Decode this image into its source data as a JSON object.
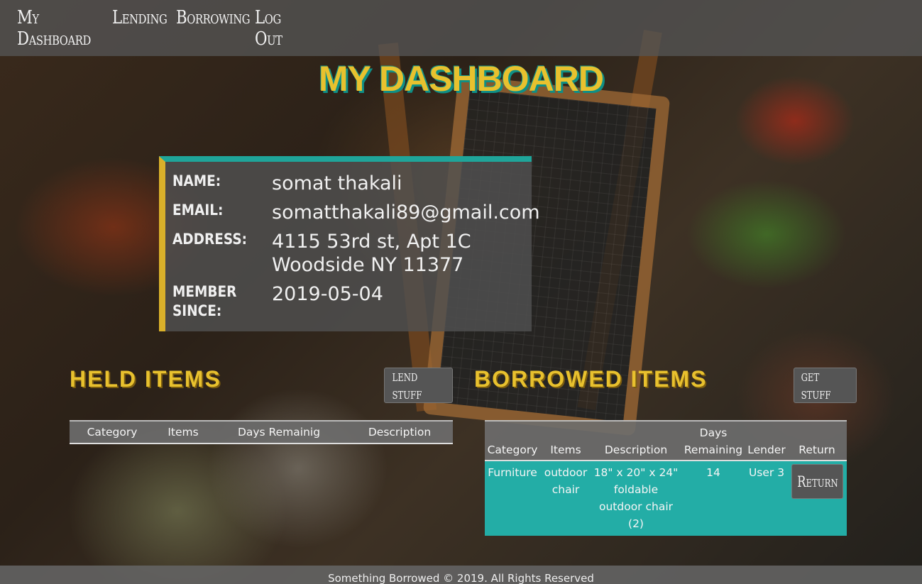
{
  "nav": {
    "items": [
      {
        "label": "My Dashboard"
      },
      {
        "label": "Lending"
      },
      {
        "label": "Borrowing"
      },
      {
        "label": "Log Out"
      }
    ]
  },
  "page_title": "MY DASHBOARD",
  "profile": {
    "name_label": "NAME:",
    "name_value": "somat thakali",
    "email_label": "EMAIL:",
    "email_value": "somatthakali89@gmail.com",
    "address_label": "ADDRESS:",
    "address_line1": "4115 53rd st, Apt 1C",
    "address_line2": "Woodside NY 11377",
    "member_label_1": "MEMBER",
    "member_label_2": "SINCE:",
    "member_value": "2019-05-04"
  },
  "held": {
    "title": "HELD ITEMS",
    "button": "lend stuff",
    "columns": [
      "Category",
      "Items",
      "Days Remainig",
      "Description"
    ]
  },
  "borrowed": {
    "title": "BORROWED ITEMS",
    "button": "get stuff",
    "columns": {
      "category": "Category",
      "items": "Items",
      "description": "Description",
      "days_1": "Days",
      "days_2": "Remaining",
      "lender": "Lender",
      "return": "Return"
    },
    "rows": [
      {
        "category": "Furniture",
        "item_1": "outdoor",
        "item_2": "chair",
        "desc_1": "18\" x 20\" x 24\"",
        "desc_2": "foldable",
        "desc_3": "outdoor chair",
        "desc_4": "(2)",
        "days": "14",
        "lender": "User 3",
        "return_button": "Return"
      }
    ]
  },
  "footer": "Something Borrowed © 2019. All Rights Reserved",
  "colors": {
    "accent_yellow": "#e8c12e",
    "accent_teal": "#1fa59a",
    "row_teal": "#23ada6"
  }
}
